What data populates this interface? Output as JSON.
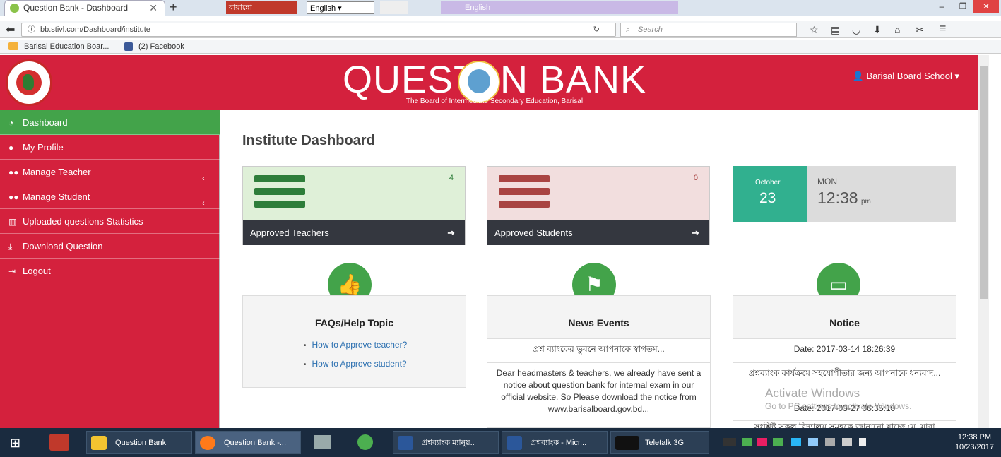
{
  "browser": {
    "tab_title": "Question Bank - Dashboard",
    "tab_close": "✕",
    "new_tab": "+",
    "ext_bangla": "বায়ান্নো",
    "ext_lang": "English",
    "ext_lang2": "English",
    "url": "bb.stivl.com/Dashboard/institute",
    "search_placeholder": "Search",
    "bookmarks": [
      "Barisal Education Boar...",
      "(2) Facebook"
    ]
  },
  "header": {
    "title": "QUESTI  N BANK",
    "subtitle": "The Board of Intermediate                         Secondary Education, Barisal",
    "user": "Barisal Board School"
  },
  "sidebar": {
    "items": [
      {
        "label": "Dashboard",
        "icon": "tachometer-icon"
      },
      {
        "label": "My Profile",
        "icon": "user-icon"
      },
      {
        "label": "Manage Teacher",
        "icon": "users-icon"
      },
      {
        "label": "Manage Student",
        "icon": "users-icon"
      },
      {
        "label": "Uploaded questions Statistics",
        "icon": "chart-icon"
      },
      {
        "label": "Download Question",
        "icon": "download-icon"
      },
      {
        "label": "Logout",
        "icon": "logout-icon"
      }
    ]
  },
  "main": {
    "title": "Institute Dashboard",
    "teachers": {
      "label": "Approved Teachers",
      "count": "4"
    },
    "students": {
      "label": "Approved Students",
      "count": "0"
    },
    "date": {
      "month": "October",
      "day": "23",
      "weekday": "MON",
      "time": "12:38",
      "ampm": "pm"
    },
    "faq": {
      "title": "FAQs/Help Topic",
      "links": [
        "How to Approve teacher?",
        "How to Approve student?"
      ]
    },
    "news": {
      "title": "News Events",
      "headline": "প্রশ্ন ব্যাংকের ভুবনে আপনাকে স্বাগতম...",
      "body": "Dear headmasters & teachers, we already have sent a notice about question bank for internal exam in our official website. So Please download the notice from www.barisalboard.gov.bd..."
    },
    "notice": {
      "title": "Notice",
      "date1": "Date: 2017-03-14 18:26:39",
      "text1": "প্রশ্নব্যাংক কার্যক্রমে সহযোগীতার জন্য আপনাকে ধন্যবাদ...",
      "date2": "Date: 2017-03-27 06:35:10",
      "text2": "সংশ্লিষ্ট সকল বিদ্যালয় সমূহকে জানানো যাচ্ছে যে, যারা"
    }
  },
  "watermark": {
    "line1": "Activate Windows",
    "line2": "Go to PC settings to activate Windows."
  },
  "taskbar": {
    "items": [
      "Question Bank",
      "Question Bank -...",
      "প্রশ্নব্যাংক ম্যানুয়..",
      "প্রশ্নব্যাংক - Micr...",
      "Teletalk 3G"
    ],
    "time": "12:38 PM",
    "date": "10/23/2017"
  },
  "colors": {
    "brand_red": "#d4213d",
    "active_green": "#43a34a",
    "teal": "#31b08f",
    "dark": "#34373f"
  }
}
